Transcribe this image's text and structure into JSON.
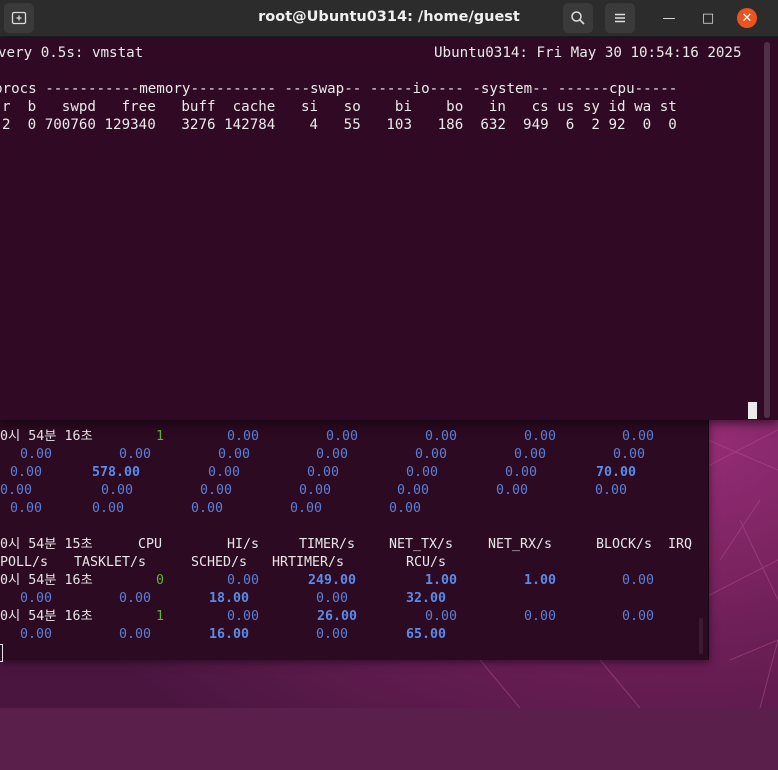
{
  "colors": {
    "terminal_bg": "#300a24",
    "titlebar_bg": "#2c2c2c",
    "accent_close": "#e95420",
    "value_blue": "#5b8be8",
    "cpu_green": "#63b22d"
  },
  "window": {
    "title": "root@Ubuntu0314: /home/guest",
    "icons": {
      "new_tab": "new-tab-icon",
      "search": "search-icon",
      "menu": "hamburger-menu-icon"
    },
    "controls": {
      "minimize": "—",
      "maximize": "□",
      "close": "✕"
    }
  },
  "front_terminal": {
    "header_left": "very 0.5s: vmstat",
    "header_right": "Ubuntu0314: Fri May 30 10:54:16 2025",
    "group_header": "procs -----------memory---------- ---swap-- -----io---- -system-- ------cpu-----",
    "column_header": "r  b   swpd   free   buff  cache   si   so    bi    bo   in   cs us sy id wa st",
    "values": "2  0 700760 129340   3276 142784    4   55   103   186  632  949  6  2 92  0  0"
  },
  "back_terminal": {
    "block1_row1": {
      "time": "0시 54분 16초",
      "cpu": "1",
      "vals": [
        "0.00",
        "0.00",
        "0.00",
        "0.00",
        "0.00"
      ]
    },
    "block1_row2": [
      "0.00",
      "0.00",
      "0.00",
      "0.00",
      "0.00",
      "0.00",
      "0.00"
    ],
    "block1_row3": [
      "0.00",
      "578.00",
      "0.00",
      "0.00",
      "0.00",
      "0.00",
      "70.00"
    ],
    "block1_row4": [
      "0.00",
      "0.00",
      "0.00",
      "0.00",
      "0.00",
      "0.00",
      "0.00"
    ],
    "block1_row5": [
      "0.00",
      "0.00",
      "0.00",
      "0.00",
      "0.00"
    ],
    "header1": {
      "time": "0시 54분 15초",
      "cols": [
        "CPU",
        "HI/s",
        "TIMER/s",
        "NET_TX/s",
        "NET_RX/s",
        "BLOCK/s",
        "IRQ"
      ]
    },
    "header2": [
      "POLL/s",
      "TASKLET/s",
      "SCHED/s",
      "HRTIMER/s",
      "RCU/s"
    ],
    "cpu0_row1": {
      "time": "0시 54분 16초",
      "cpu": "0",
      "vals": [
        "0.00",
        "249.00",
        "1.00",
        "1.00",
        "0.00"
      ]
    },
    "cpu0_row2": [
      "0.00",
      "0.00",
      "18.00",
      "0.00",
      "32.00"
    ],
    "cpu1_row1": {
      "time": "0시 54분 16초",
      "cpu": "1",
      "vals": [
        "0.00",
        "26.00",
        "0.00",
        "0.00",
        "0.00"
      ]
    },
    "cpu1_row2": [
      "0.00",
      "0.00",
      "16.00",
      "0.00",
      "65.00"
    ]
  }
}
